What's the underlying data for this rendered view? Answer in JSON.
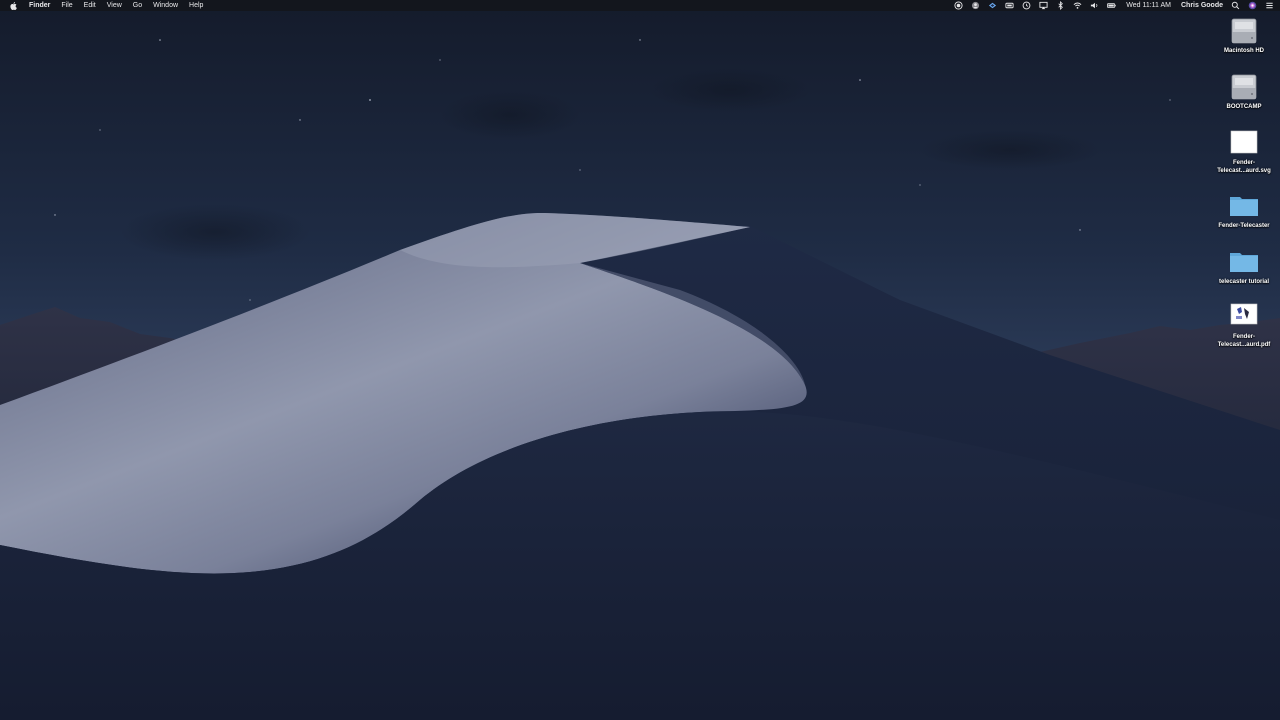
{
  "menubar": {
    "apple_icon": "apple-logo-icon",
    "menus": [
      "Finder",
      "File",
      "Edit",
      "View",
      "Go",
      "Window",
      "Help"
    ],
    "status_icons": [
      "record-icon",
      "user-shield-icon",
      "dropbox-icon",
      "battery-box-icon",
      "time-machine-icon",
      "airplay-icon",
      "bluetooth-icon",
      "wifi-icon",
      "volume-icon",
      "battery-icon"
    ],
    "clock": "Wed 11:11 AM",
    "user": "Chris Goode",
    "search_icon": "spotlight-search-icon",
    "siri_icon": "siri-icon",
    "accent": "#e8e8ea"
  },
  "desktop_icons": [
    {
      "label": "Macintosh HD",
      "icon": "hard-drive-icon"
    },
    {
      "label": "BOOTCAMP",
      "icon": "hard-drive-icon"
    },
    {
      "label": "Fender-\nTelecast...aurd.svg",
      "icon": "svg-file-icon"
    },
    {
      "label": "Fender-Telecaster",
      "icon": "folder-icon"
    },
    {
      "label": "telecaster tutorial",
      "icon": "folder-icon"
    },
    {
      "label": "Fender-\nTelecast...aurd.pdf",
      "icon": "pdf-file-icon"
    }
  ],
  "wallpaper": {
    "sky_top": "#141c2d",
    "sky_bottom": "#2a3a55",
    "dune_light": "#8d93a8",
    "dune_dark": "#1c2640"
  }
}
